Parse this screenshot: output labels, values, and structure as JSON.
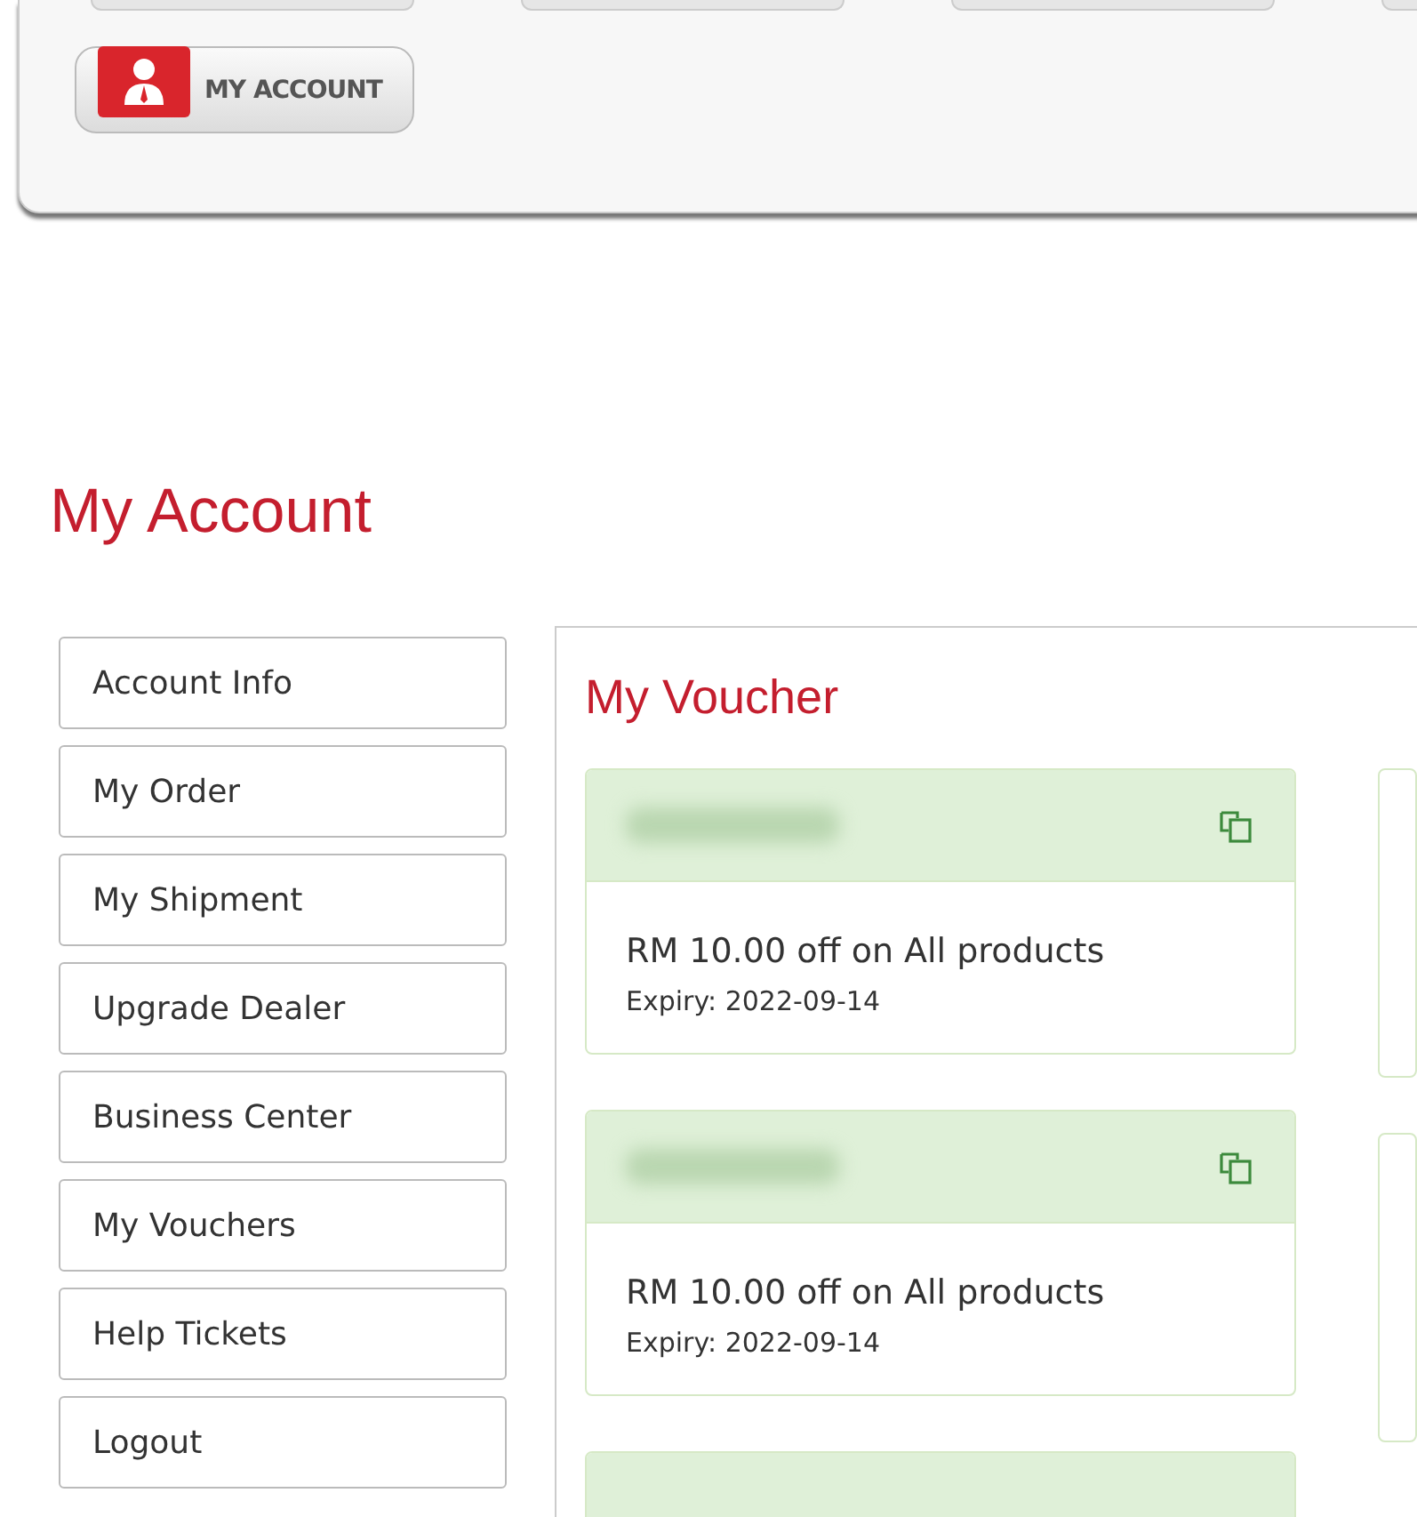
{
  "header": {
    "account_button": "MY ACCOUNT"
  },
  "page_title": "My Account",
  "sidebar": {
    "items": [
      {
        "label": "Account Info",
        "selected": false
      },
      {
        "label": "My Order",
        "selected": false
      },
      {
        "label": "My Shipment",
        "selected": false
      },
      {
        "label": "Upgrade Dealer",
        "selected": false
      },
      {
        "label": "Business Center",
        "selected": false
      },
      {
        "label": "My Vouchers",
        "selected": false
      },
      {
        "label": "Help Tickets",
        "selected": false
      },
      {
        "label": "Logout",
        "selected": false
      }
    ]
  },
  "content": {
    "title": "My Voucher",
    "vouchers": [
      {
        "description": "RM 10.00 off on All products",
        "expiry": "Expiry: 2022-09-14"
      },
      {
        "description": "RM 10.00 off on All products",
        "expiry": "Expiry: 2022-09-14"
      }
    ]
  }
}
